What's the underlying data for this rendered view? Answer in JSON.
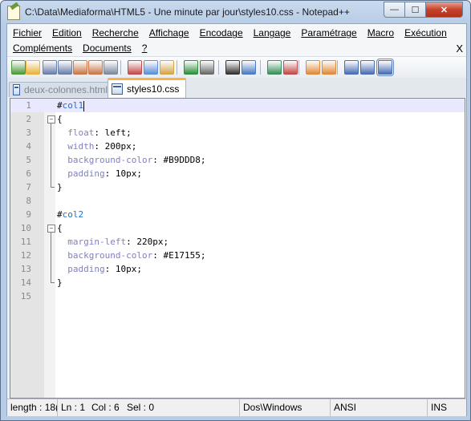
{
  "window": {
    "title": "C:\\Data\\Mediaforma\\HTML5 - Une minute par jour\\styles10.css - Notepad++",
    "close_glyph": "✕",
    "max_glyph": "☐",
    "min_glyph": "—"
  },
  "menu": {
    "row1": [
      "Fichier",
      "Edition",
      "Recherche",
      "Affichage",
      "Encodage",
      "Langage",
      "Paramétrage",
      "Macro",
      "Exécution"
    ],
    "row2": [
      "Compléments",
      "Documents",
      "?"
    ],
    "close_doc": "X"
  },
  "tabs": [
    {
      "label": "deux-colonnes.html",
      "active": false
    },
    {
      "label": "styles10.css",
      "active": true
    }
  ],
  "editor": {
    "lines": [
      {
        "n": "1",
        "text": "#col1"
      },
      {
        "n": "2",
        "text": "{"
      },
      {
        "n": "3",
        "text": "  float: left;"
      },
      {
        "n": "4",
        "text": "  width: 200px;"
      },
      {
        "n": "5",
        "text": "  background-color: #B9DDD8;"
      },
      {
        "n": "6",
        "text": "  padding: 10px;"
      },
      {
        "n": "7",
        "text": "}"
      },
      {
        "n": "8",
        "text": ""
      },
      {
        "n": "9",
        "text": "#col2"
      },
      {
        "n": "10",
        "text": "{"
      },
      {
        "n": "11",
        "text": "  margin-left: 220px;"
      },
      {
        "n": "12",
        "text": "  background-color: #E17155;"
      },
      {
        "n": "13",
        "text": "  padding: 10px;"
      },
      {
        "n": "14",
        "text": "}"
      },
      {
        "n": "15",
        "text": ""
      }
    ]
  },
  "status": {
    "length": "length : 18(",
    "ln": "Ln : 1",
    "col": "Col : 6",
    "sel": "Sel : 0",
    "eol": "Dos\\Windows",
    "encoding": "ANSI",
    "mode": "INS"
  },
  "toolbar_icons": [
    "new-file-icon",
    "open-file-icon",
    "save-icon",
    "save-all-icon",
    "close-icon",
    "close-all-icon",
    "print-icon",
    "cut-icon",
    "copy-icon",
    "paste-icon",
    "undo-icon",
    "redo-icon",
    "find-icon",
    "replace-icon",
    "zoom-in-icon",
    "zoom-out-icon",
    "sync-v-icon",
    "sync-h-icon",
    "word-wrap-icon",
    "show-all-chars-icon",
    "indent-guide-icon"
  ]
}
